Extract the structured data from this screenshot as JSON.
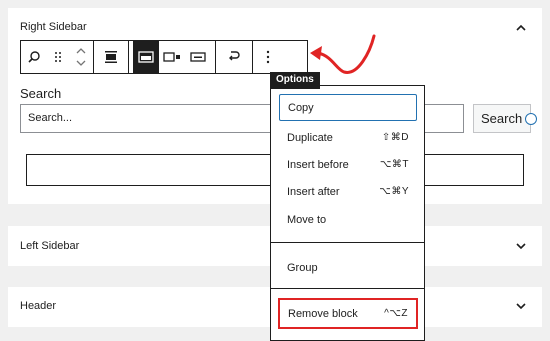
{
  "panels": {
    "right_sidebar": {
      "title": "Right Sidebar",
      "state": "expanded"
    },
    "left_sidebar": {
      "title": "Left Sidebar",
      "state": "collapsed"
    },
    "header": {
      "title": "Header",
      "state": "collapsed"
    }
  },
  "toolbar": {
    "icons": [
      "search-icon",
      "drag-handle-icon",
      "move-up-down-icon",
      "align-icon",
      "button-inside-icon",
      "button-outside-icon",
      "no-button-icon",
      "transform-icon",
      "more-options-icon"
    ],
    "active_icon": "button-inside-icon"
  },
  "search_block": {
    "label": "Search",
    "placeholder": "Search...",
    "button_label": "Search"
  },
  "tooltip": "Options",
  "menu": {
    "items": [
      {
        "label": "Copy",
        "shortcut": ""
      },
      {
        "label": "Duplicate",
        "shortcut": "⇧⌘D"
      },
      {
        "label": "Insert before",
        "shortcut": "⌥⌘T"
      },
      {
        "label": "Insert after",
        "shortcut": "⌥⌘Y"
      },
      {
        "label": "Move to",
        "shortcut": ""
      },
      {
        "label": "Group",
        "shortcut": ""
      },
      {
        "label": "Remove block",
        "shortcut": "^⌥Z"
      }
    ],
    "focused": "Copy",
    "highlighted": "Remove block"
  },
  "colors": {
    "highlight_red": "#e02424",
    "focus_blue": "#2271b1",
    "dark": "#1e1e1e"
  }
}
